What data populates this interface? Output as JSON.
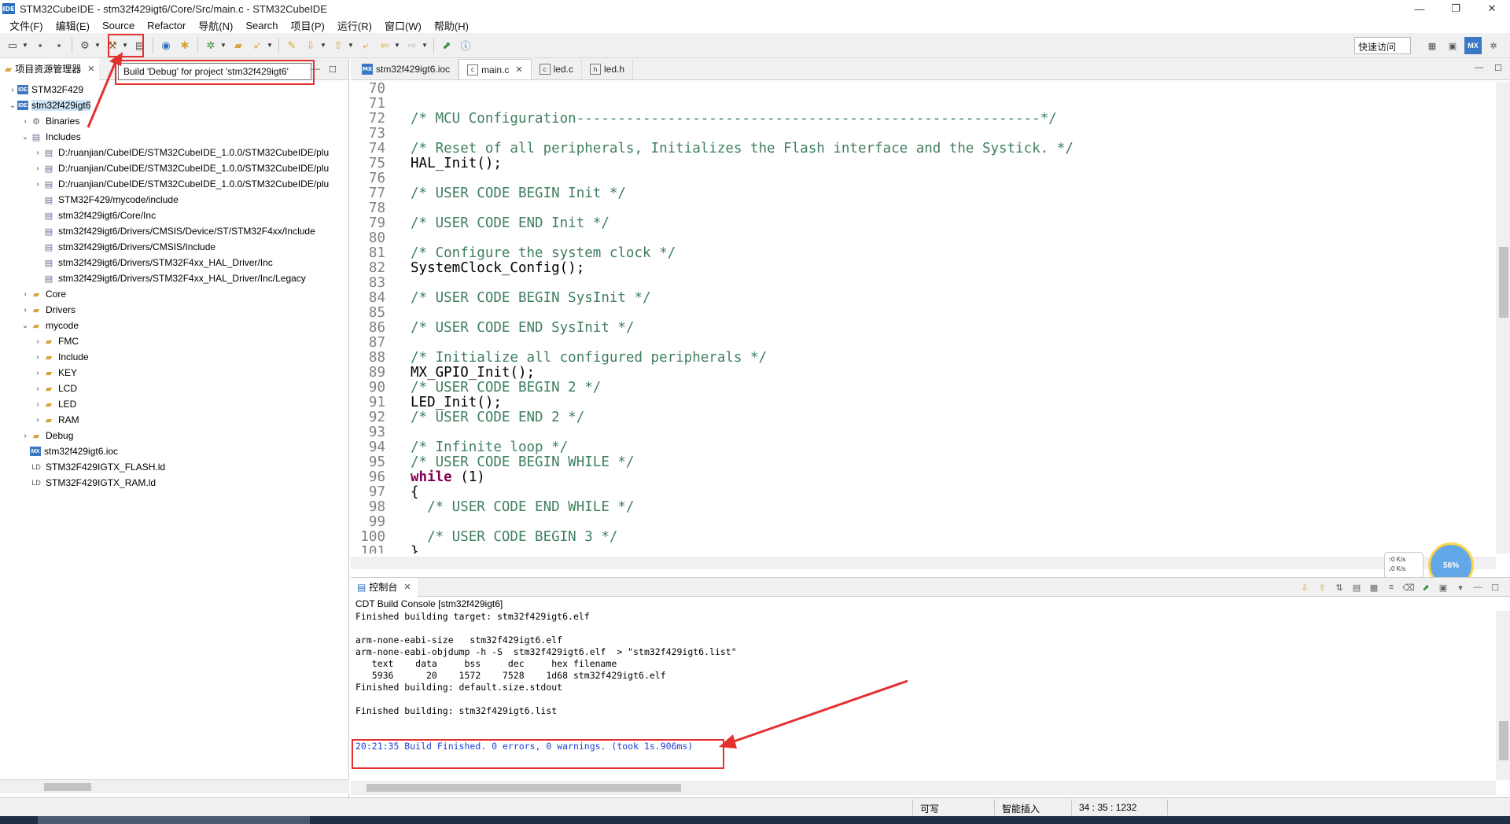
{
  "window": {
    "app_icon": "IDE",
    "title": "STM32CubeIDE - stm32f429igt6/Core/Src/main.c - STM32CubeIDE",
    "min": "—",
    "max": "❐",
    "close": "✕"
  },
  "menu": [
    "文件(F)",
    "编辑(E)",
    "Source",
    "Refactor",
    "导航(N)",
    "Search",
    "项目(P)",
    "运行(R)",
    "窗口(W)",
    "帮助(H)"
  ],
  "toolbar": {
    "quick_access": "快速访问",
    "tooltip": "Build 'Debug' for project 'stm32f429igt6'",
    "perspective_mx": "MX"
  },
  "explorer": {
    "tab_label": "项目资源管理器",
    "items": [
      {
        "label": "STM32F429",
        "level": 0,
        "twisty": "›",
        "icon": "ide-project-icon",
        "glyph": "IDE"
      },
      {
        "label": "stm32f429igt6",
        "level": 0,
        "twisty": "⌄",
        "icon": "ide-project-icon",
        "glyph": "IDE"
      },
      {
        "label": "Binaries",
        "level": 1,
        "twisty": "›",
        "icon": "binaries-icon",
        "glyph": "⚙"
      },
      {
        "label": "Includes",
        "level": 1,
        "twisty": "⌄",
        "icon": "includes-icon",
        "glyph": "▤"
      },
      {
        "label": "D:/ruanjian/CubeIDE/STM32CubeIDE_1.0.0/STM32CubeIDE/plu",
        "level": 2,
        "twisty": "›",
        "icon": "include-path-icon",
        "glyph": "▤"
      },
      {
        "label": "D:/ruanjian/CubeIDE/STM32CubeIDE_1.0.0/STM32CubeIDE/plu",
        "level": 2,
        "twisty": "›",
        "icon": "include-path-icon",
        "glyph": "▤"
      },
      {
        "label": "D:/ruanjian/CubeIDE/STM32CubeIDE_1.0.0/STM32CubeIDE/plu",
        "level": 2,
        "twisty": "›",
        "icon": "include-path-icon",
        "glyph": "▤"
      },
      {
        "label": "STM32F429/mycode/include",
        "level": 2,
        "twisty": "",
        "icon": "include-path-icon",
        "glyph": "▤"
      },
      {
        "label": "stm32f429igt6/Core/Inc",
        "level": 2,
        "twisty": "",
        "icon": "include-path-icon",
        "glyph": "▤"
      },
      {
        "label": "stm32f429igt6/Drivers/CMSIS/Device/ST/STM32F4xx/Include",
        "level": 2,
        "twisty": "",
        "icon": "include-path-icon",
        "glyph": "▤"
      },
      {
        "label": "stm32f429igt6/Drivers/CMSIS/Include",
        "level": 2,
        "twisty": "",
        "icon": "include-path-icon",
        "glyph": "▤"
      },
      {
        "label": "stm32f429igt6/Drivers/STM32F4xx_HAL_Driver/Inc",
        "level": 2,
        "twisty": "",
        "icon": "include-path-icon",
        "glyph": "▤"
      },
      {
        "label": "stm32f429igt6/Drivers/STM32F4xx_HAL_Driver/Inc/Legacy",
        "level": 2,
        "twisty": "",
        "icon": "include-path-icon",
        "glyph": "▤"
      },
      {
        "label": "Core",
        "level": 1,
        "twisty": "›",
        "icon": "folder-icon",
        "glyph": "▰"
      },
      {
        "label": "Drivers",
        "level": 1,
        "twisty": "›",
        "icon": "folder-icon",
        "glyph": "▰"
      },
      {
        "label": "mycode",
        "level": 1,
        "twisty": "⌄",
        "icon": "folder-icon",
        "glyph": "▰"
      },
      {
        "label": "FMC",
        "level": 2,
        "twisty": "›",
        "icon": "folder-icon",
        "glyph": "▰"
      },
      {
        "label": "Include",
        "level": 2,
        "twisty": "›",
        "icon": "folder-icon",
        "glyph": "▰"
      },
      {
        "label": "KEY",
        "level": 2,
        "twisty": "›",
        "icon": "folder-icon",
        "glyph": "▰"
      },
      {
        "label": "LCD",
        "level": 2,
        "twisty": "›",
        "icon": "folder-icon",
        "glyph": "▰"
      },
      {
        "label": "LED",
        "level": 2,
        "twisty": "›",
        "icon": "folder-icon",
        "glyph": "▰"
      },
      {
        "label": "RAM",
        "level": 2,
        "twisty": "›",
        "icon": "folder-icon",
        "glyph": "▰"
      },
      {
        "label": "Debug",
        "level": 1,
        "twisty": "›",
        "icon": "folder-icon",
        "glyph": "▰"
      },
      {
        "label": "stm32f429igt6.ioc",
        "level": 1,
        "twisty": "",
        "icon": "mx-file-icon",
        "glyph": "MX"
      },
      {
        "label": "STM32F429IGTX_FLASH.ld",
        "level": 1,
        "twisty": "",
        "icon": "ld-file-icon",
        "glyph": "LD"
      },
      {
        "label": "STM32F429IGTX_RAM.ld",
        "level": 1,
        "twisty": "",
        "icon": "ld-file-icon",
        "glyph": "LD"
      }
    ]
  },
  "editor": {
    "tabs": [
      {
        "label": "stm32f429igt6.ioc",
        "icon": "MX",
        "active": false
      },
      {
        "label": "main.c",
        "icon": "c",
        "active": true
      },
      {
        "label": "led.c",
        "icon": "c",
        "active": false
      },
      {
        "label": "led.h",
        "icon": "h",
        "active": false
      }
    ],
    "lines": [
      {
        "n": "70",
        "t": ""
      },
      {
        "n": "71",
        "t": ""
      },
      {
        "n": "72",
        "t": "/* MCU Configuration--------------------------------------------------------*/",
        "c": "cm"
      },
      {
        "n": "73",
        "t": ""
      },
      {
        "n": "74",
        "t": "/* Reset of all peripherals, Initializes the Flash interface and the Systick. */",
        "c": "cm"
      },
      {
        "n": "75",
        "t": "HAL_Init();"
      },
      {
        "n": "76",
        "t": ""
      },
      {
        "n": "77",
        "t": "/* USER CODE BEGIN Init */",
        "c": "cm"
      },
      {
        "n": "78",
        "t": ""
      },
      {
        "n": "79",
        "t": "/* USER CODE END Init */",
        "c": "cm"
      },
      {
        "n": "80",
        "t": ""
      },
      {
        "n": "81",
        "t": "/* Configure the system clock */",
        "c": "cm"
      },
      {
        "n": "82",
        "t": "SystemClock_Config();"
      },
      {
        "n": "83",
        "t": ""
      },
      {
        "n": "84",
        "t": "/* USER CODE BEGIN SysInit */",
        "c": "cm"
      },
      {
        "n": "85",
        "t": ""
      },
      {
        "n": "86",
        "t": "/* USER CODE END SysInit */",
        "c": "cm"
      },
      {
        "n": "87",
        "t": ""
      },
      {
        "n": "88",
        "t": "/* Initialize all configured peripherals */",
        "c": "cm"
      },
      {
        "n": "89",
        "t": "MX_GPIO_Init();"
      },
      {
        "n": "90",
        "t": "/* USER CODE BEGIN 2 */",
        "c": "cm"
      },
      {
        "n": "91",
        "t": "LED_Init();"
      },
      {
        "n": "92",
        "t": "/* USER CODE END 2 */",
        "c": "cm"
      },
      {
        "n": "93",
        "t": ""
      },
      {
        "n": "94",
        "t": "/* Infinite loop */",
        "c": "cm"
      },
      {
        "n": "95",
        "t": "/* USER CODE BEGIN WHILE */",
        "c": "cm"
      },
      {
        "n": "96",
        "kw": "while",
        "t": " (1)"
      },
      {
        "n": "97",
        "t": "{"
      },
      {
        "n": "98",
        "t": "  /* USER CODE END WHILE */",
        "c": "cm"
      },
      {
        "n": "99",
        "t": ""
      },
      {
        "n": "100",
        "t": "  /* USER CODE BEGIN 3 */",
        "c": "cm"
      },
      {
        "n": "101",
        "t": "}"
      }
    ]
  },
  "widget": {
    "up_speed": "↑0  K/s",
    "down_speed": "↓0  K/s",
    "percent": "56%"
  },
  "console": {
    "tab_label": "控制台",
    "title": "CDT Build Console [stm32f429igt6]",
    "lines": [
      "Finished building target: stm32f429igt6.elf",
      "",
      "arm-none-eabi-size   stm32f429igt6.elf",
      "arm-none-eabi-objdump -h -S  stm32f429igt6.elf  > \"stm32f429igt6.list\"",
      "   text    data     bss     dec     hex filename",
      "   5936      20    1572    7528    1d68 stm32f429igt6.elf",
      "Finished building: default.size.stdout",
      "",
      "Finished building: stm32f429igt6.list",
      "",
      ""
    ],
    "result": "20:21:35 Build Finished. 0 errors, 0 warnings. (took 1s.906ms)"
  },
  "status": {
    "writable": "可写",
    "insert_mode": "智能插入",
    "position": "34 : 35 : 1232"
  },
  "colors": {
    "highlight": "#e53030",
    "comment": "#3f7f5f",
    "keyword": "#7f0055",
    "console_blue": "#1f3fd6"
  }
}
